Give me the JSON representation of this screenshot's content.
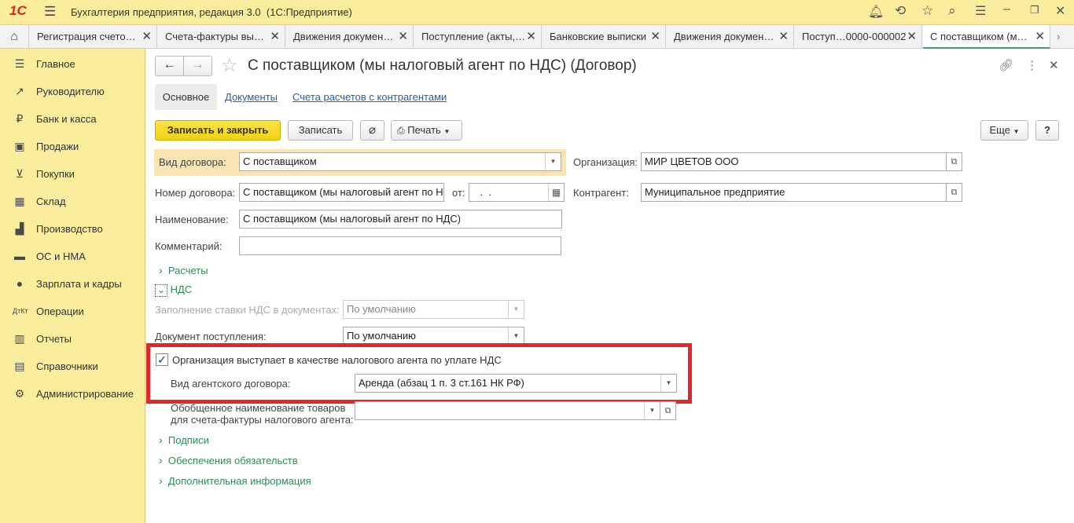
{
  "app": {
    "logo": "1С",
    "title": "Бухгалтерия предприятия, редакция 3.0  (1С:Предприятие)"
  },
  "tabs": [
    {
      "label": "Регистрация счето…"
    },
    {
      "label": "Счета-фактуры вы…"
    },
    {
      "label": "Движения докумен…"
    },
    {
      "label": "Поступление (акты,…"
    },
    {
      "label": "Банковские выписки"
    },
    {
      "label": "Движения докумен…"
    },
    {
      "label": "Поступ…0000-000002"
    },
    {
      "label": "С поставщиком (м…"
    }
  ],
  "sidebar": {
    "items": [
      {
        "label": "Главное",
        "icon": "menu-icon"
      },
      {
        "label": "Руководителю",
        "icon": "trend-icon"
      },
      {
        "label": "Банк и касса",
        "icon": "ruble-icon"
      },
      {
        "label": "Продажи",
        "icon": "bag-icon"
      },
      {
        "label": "Покупки",
        "icon": "cart-icon"
      },
      {
        "label": "Склад",
        "icon": "warehouse-icon"
      },
      {
        "label": "Производство",
        "icon": "factory-icon"
      },
      {
        "label": "ОС и НМА",
        "icon": "truck-icon"
      },
      {
        "label": "Зарплата и кадры",
        "icon": "person-icon"
      },
      {
        "label": "Операции",
        "icon": "dt-kt-icon"
      },
      {
        "label": "Отчеты",
        "icon": "report-icon"
      },
      {
        "label": "Справочники",
        "icon": "book-icon"
      },
      {
        "label": "Администрирование",
        "icon": "gear-icon"
      }
    ]
  },
  "form": {
    "title": "С поставщиком (мы налоговый агент по НДС) (Договор)",
    "subtabs": {
      "main": "Основное",
      "documents": "Документы",
      "accounts": "Счета расчетов с контрагентами"
    },
    "toolbar": {
      "save_close": "Записать и закрыть",
      "save": "Записать",
      "print": "Печать",
      "more": "Еще",
      "help": "?"
    },
    "fields": {
      "contract_type_label": "Вид договора:",
      "contract_type_value": "С поставщиком",
      "organization_label": "Организация:",
      "organization_value": "МИР ЦВЕТОВ ООО",
      "number_label": "Номер договора:",
      "number_value": "С поставщиком (мы налоговый агент по Н",
      "date_label": "от:",
      "date_value": " .  .",
      "counterparty_label": "Контрагент:",
      "counterparty_value": "Муниципальное предприятие",
      "name_label": "Наименование:",
      "name_value": "С поставщиком (мы налоговый агент по НДС)",
      "comment_label": "Комментарий:",
      "comment_value": ""
    },
    "groups": {
      "settlements": "Расчеты",
      "vat": "НДС",
      "signatures": "Подписи",
      "collateral": "Обеспечения обязательств",
      "additional": "Дополнительная информация"
    },
    "vat": {
      "rate_fill_label": "Заполнение ставки НДС в документах:",
      "rate_fill_value": "По умолчанию",
      "receipt_doc_label": "Документ поступления:",
      "receipt_doc_value": "По умолчанию",
      "tax_agent_checkbox": "Организация выступает в качестве налогового агента по уплате НДС",
      "tax_agent_checked": true,
      "agent_contract_type_label": "Вид агентского договора:",
      "agent_contract_type_value": "Аренда (абзац 1 п. 3 ст.161 НК РФ)",
      "goods_name_label_1": "Обобщенное наименование товаров",
      "goods_name_label_2": "для счета-фактуры налогового агента:",
      "goods_name_value": ""
    }
  },
  "colors": {
    "brand_yellow": "#fbed9e",
    "primary_button": "#f5d81f",
    "group_green": "#2e8b57",
    "highlight_red": "#e3262b",
    "link_blue": "#2a5d9e"
  }
}
